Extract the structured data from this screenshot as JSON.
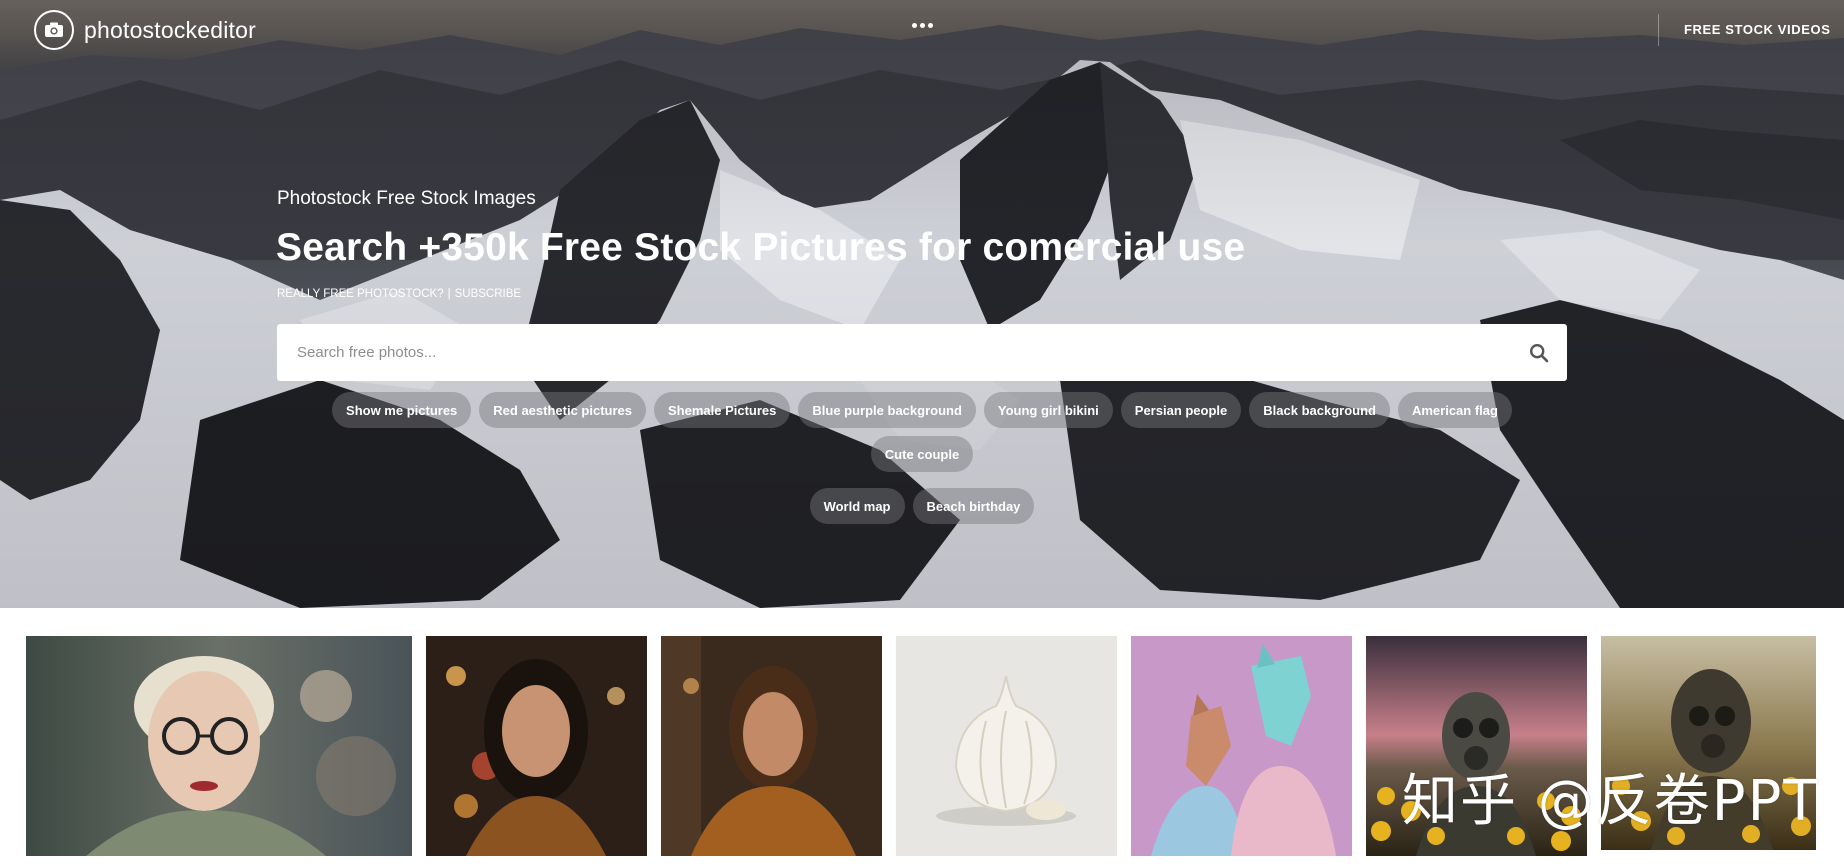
{
  "header": {
    "logo_text": "photostockeditor",
    "logo_icon": "camera-icon",
    "more_icon": "more-dots-icon",
    "videos_link": "FREE STOCK VIDEOS"
  },
  "hero": {
    "eyebrow": "Photostock Free Stock Images",
    "headline": "Search +350k Free Stock Pictures for comercial use",
    "sublinks": {
      "really_free": "REALLY FREE PHOTOSTOCK?",
      "separator": "|",
      "subscribe": "SUBSCRIBE"
    },
    "search": {
      "placeholder": "Search free photos...",
      "value": "",
      "icon": "search-icon"
    },
    "tags": [
      "Show me pictures",
      "Red aesthetic pictures",
      "Shemale Pictures",
      "Blue purple background",
      "Young girl bikini",
      "Persian people",
      "Black background",
      "American flag",
      "Cute couple",
      "World map",
      "Beach birthday"
    ]
  },
  "gallery": {
    "items": [
      {
        "subject": "woman-with-glasses"
      },
      {
        "subject": "woman-dark-hair-lights"
      },
      {
        "subject": "woman-brown-coat"
      },
      {
        "subject": "garlic-bulb"
      },
      {
        "subject": "dog-headed-couple"
      },
      {
        "subject": "gas-mask-sunflowers"
      },
      {
        "subject": "gas-mask-field"
      }
    ]
  },
  "watermark": "知乎 @反卷PPT",
  "colors": {
    "hero_text": "#ffffff",
    "tag_bg": "rgba(120,120,125,0.45)",
    "search_bg": "#ffffff"
  }
}
